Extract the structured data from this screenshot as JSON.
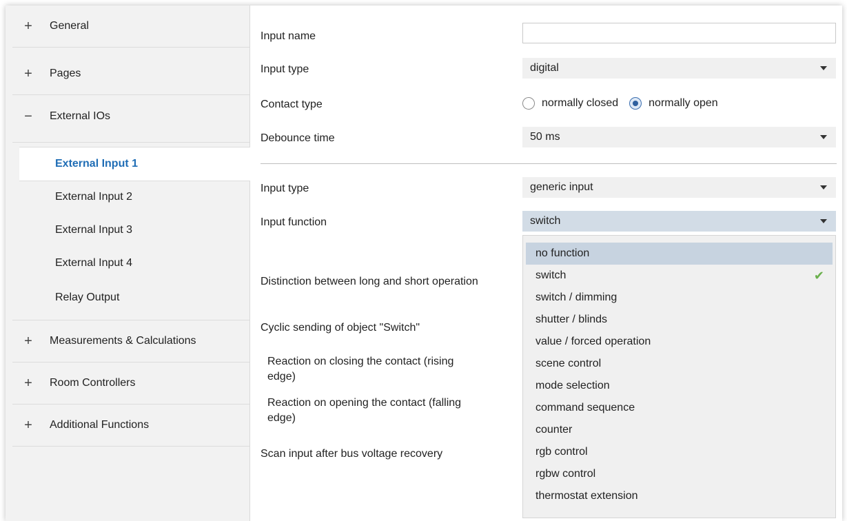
{
  "sidebar": {
    "groups": [
      {
        "sign": "+",
        "label": "General"
      },
      {
        "sign": "+",
        "label": "Pages"
      },
      {
        "sign": "−",
        "label": "External IOs"
      },
      {
        "sign": "+",
        "label": "Measurements & Calculations"
      },
      {
        "sign": "+",
        "label": "Room Controllers"
      },
      {
        "sign": "+",
        "label": "Additional Functions"
      }
    ],
    "subitems": [
      {
        "label": "External Input 1",
        "active": true
      },
      {
        "label": "External Input 2",
        "active": false
      },
      {
        "label": "External Input 3",
        "active": false
      },
      {
        "label": "External Input 4",
        "active": false
      },
      {
        "label": "Relay Output",
        "active": false
      }
    ]
  },
  "form": {
    "input_name_label": "Input name",
    "input_name_value": "",
    "input_type_label": "Input type",
    "input_type_value": "digital",
    "contact_type_label": "Contact type",
    "contact_options": [
      {
        "label": "normally closed",
        "checked": false
      },
      {
        "label": "normally open",
        "checked": true
      }
    ],
    "debounce_label": "Debounce time",
    "debounce_value": "50 ms",
    "input_type2_label": "Input type",
    "input_type2_value": "generic input",
    "input_function_label": "Input function",
    "input_function_value": "switch",
    "distinction_label": "Distinction between long and short operation",
    "cyclic_label": "Cyclic sending of object \"Switch\"",
    "reaction_closing_label": "Reaction on closing the contact (rising edge)",
    "reaction_opening_label": "Reaction on opening the contact (falling edge)",
    "scan_label": "Scan input after bus voltage recovery"
  },
  "dropdown": {
    "options": [
      "no function",
      "switch",
      "switch / dimming",
      "shutter / blinds",
      "value / forced operation",
      "scene control",
      "mode selection",
      "command sequence",
      "counter",
      "rgb control",
      "rgbw control",
      "thermostat extension"
    ],
    "hovered": "no function",
    "selected": "switch",
    "check_glyph": "✔"
  },
  "colors": {
    "accent": "#1f6db5",
    "check": "#6ab04c",
    "hover": "#c7d3e0"
  }
}
